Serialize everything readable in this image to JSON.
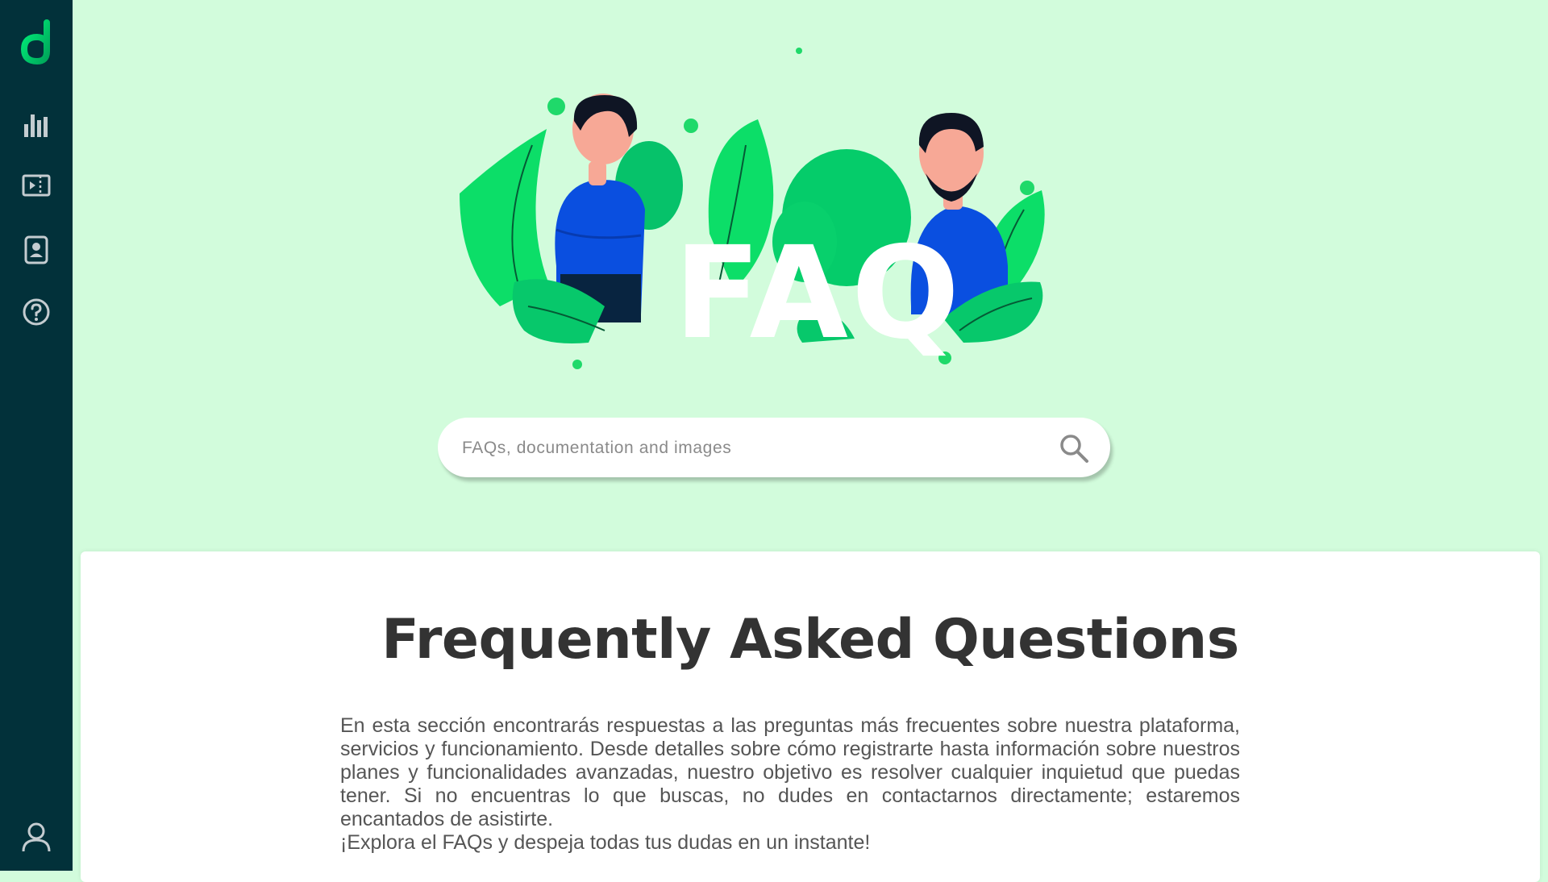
{
  "sidebar": {
    "logo": "d-logo",
    "items": [
      {
        "icon": "bar-chart-icon",
        "label": ""
      },
      {
        "icon": "video-ticket-icon",
        "label": ""
      },
      {
        "icon": "contact-card-icon",
        "label": ""
      },
      {
        "icon": "help-circle-icon",
        "label": ""
      }
    ],
    "footer_icon": "user-icon"
  },
  "hero": {
    "illustration_text": "FAQ",
    "search": {
      "placeholder": "FAQs, documentation and images",
      "value": ""
    }
  },
  "content": {
    "title": "Frequently Asked Questions",
    "description": "En esta sección encontrarás respuestas a las preguntas más frecuentes sobre nuestra plataforma, servicios y funcionamiento. Desde detalles sobre cómo registrarte hasta información sobre nuestros planes y funcionalidades avanzadas, nuestro objetivo es resolver cualquier inquietud que puedas tener. Si no encuentras lo que buscas, no dudes en contactarnos directamente; estaremos encantados de asistirte.",
    "cta": "¡Explora el FAQs y despeja todas tus dudas en un instante!"
  },
  "colors": {
    "sidebar": "#02313a",
    "accent": "#00e676",
    "hero_bg": "#d2fcdc",
    "text": "#333333",
    "person_shirt": "#0a4fe0"
  }
}
